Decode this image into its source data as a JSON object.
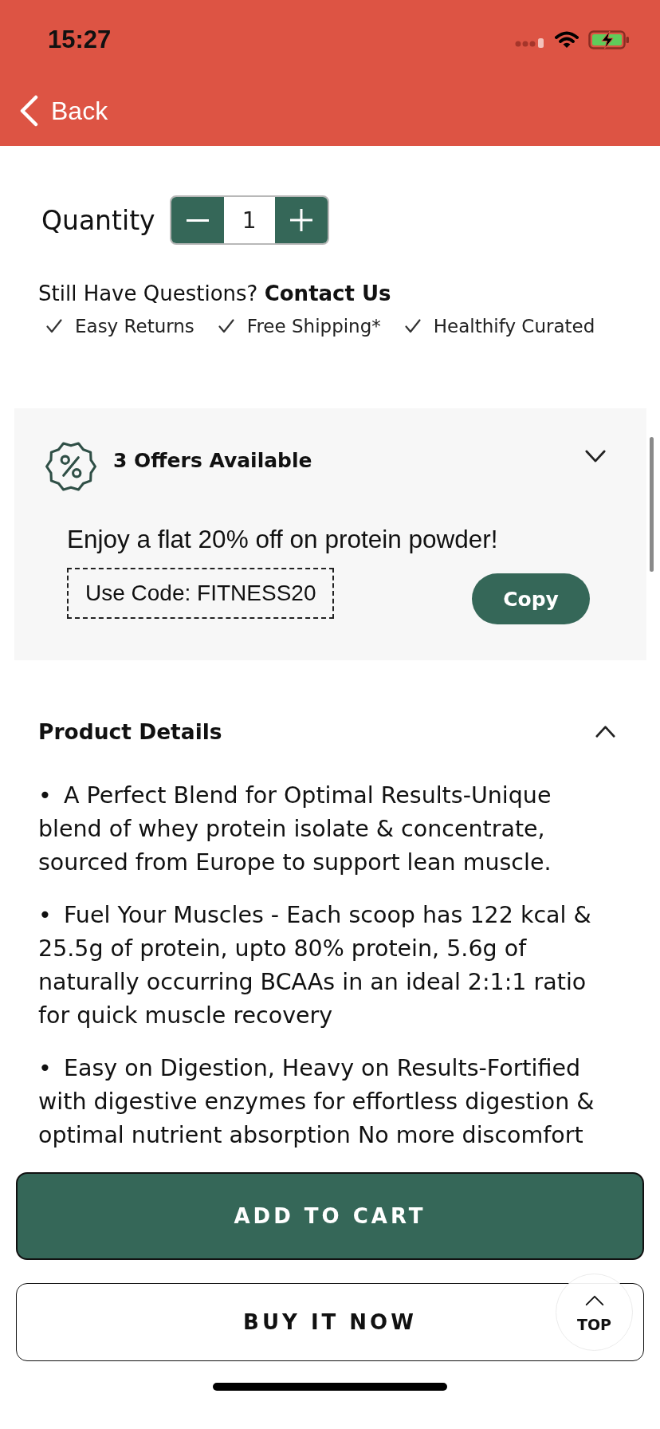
{
  "status_bar": {
    "time": "15:27"
  },
  "nav_bar": {
    "back_label": "Back"
  },
  "quantity": {
    "label": "Quantity",
    "value": "1"
  },
  "contact": {
    "question": "Still Have Questions?",
    "link": "Contact Us"
  },
  "perks": [
    {
      "label": "Easy Returns"
    },
    {
      "label": "Free Shipping*"
    },
    {
      "label": "Healthify Curated"
    }
  ],
  "offers": {
    "title": "3 Offers Available",
    "expanded": false,
    "items": [
      {
        "description": "Enjoy a flat 20% off on protein powder!",
        "code": "Use Code: FITNESS20",
        "action": "Copy"
      }
    ]
  },
  "product_details": {
    "title": "Product Details",
    "expanded": true,
    "bullets": [
      {
        "marker": "•",
        "text": "A Perfect Blend for Optimal Results-Unique blend of whey protein isolate & concentrate, sourced from Europe to support lean muscle."
      },
      {
        "marker": "•",
        "text": "Fuel Your Muscles - Each scoop has 122 kcal & 25.5g of protein, upto 80% protein, 5.6g of naturally occurring BCAAs in an ideal 2:1:1 ratio for quick muscle recovery"
      },
      {
        "marker": "•",
        "text": "Easy on Digestion, Heavy on Results-Fortified with digestive enzymes for effortless digestion & optimal nutrient absorption No more discomfort"
      }
    ]
  },
  "actions": {
    "add_to_cart": "ADD TO CART",
    "buy_now": "BUY IT NOW"
  },
  "scroll_top": {
    "label": "TOP"
  }
}
